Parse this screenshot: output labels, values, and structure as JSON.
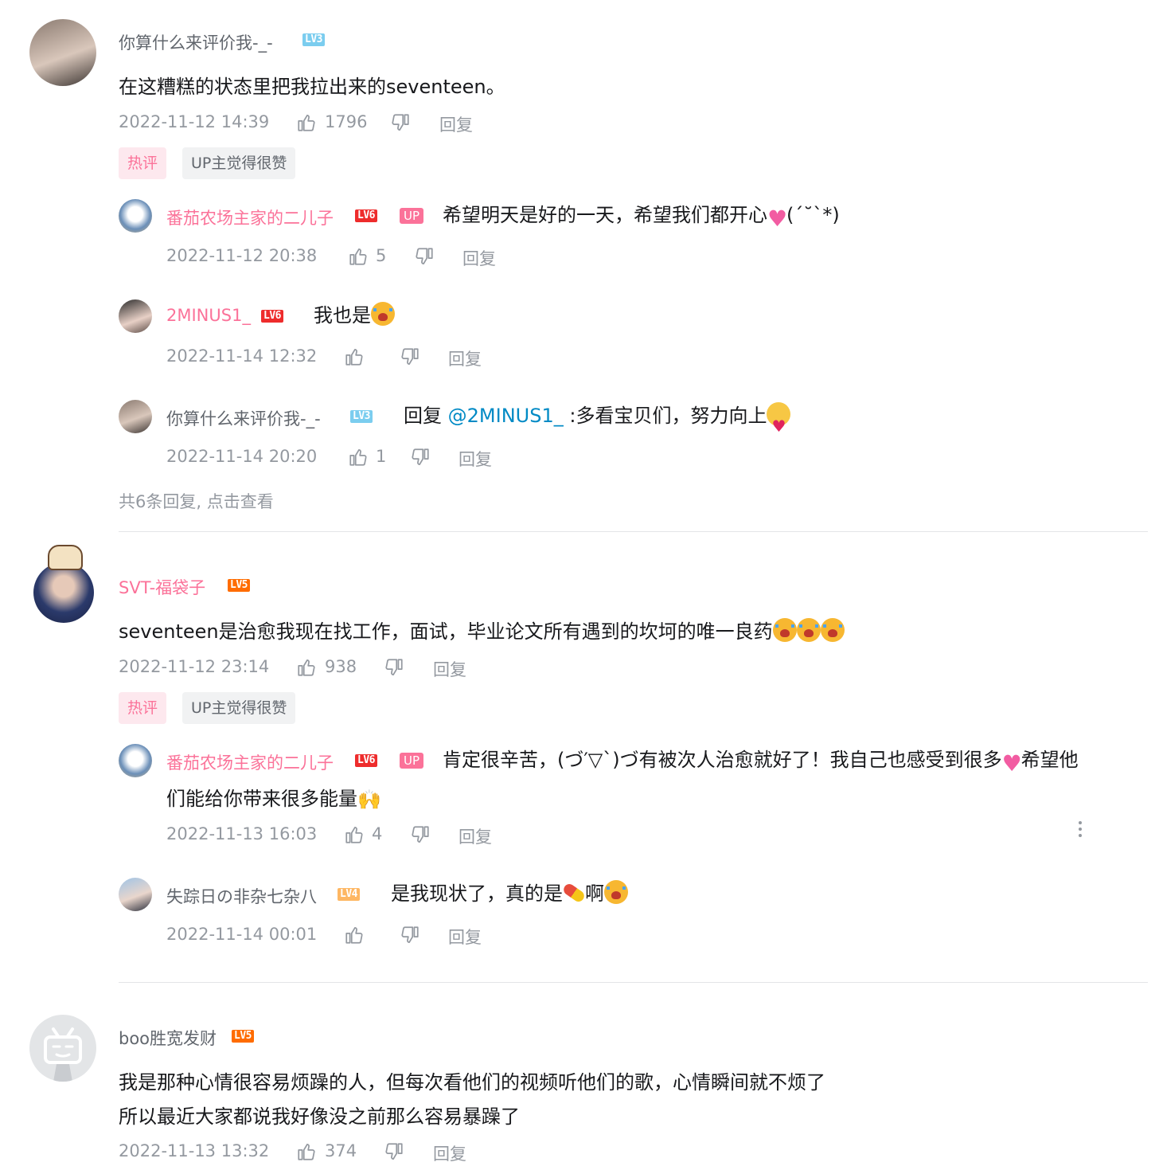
{
  "comments": [
    {
      "user": "你算什么来评价我-_-",
      "level": "LV3",
      "text": "在这糟糕的状态里把我拉出来的seventeen。",
      "time": "2022-11-12 14:39",
      "likes": "1796",
      "reply_label": "回复",
      "tag_hot": "热评",
      "tag_up": "UP主觉得很赞",
      "replies": [
        {
          "user": "番茄农场主家的二儿子",
          "level": "LV6",
          "up": "UP",
          "text": "希望明天是好的一天，希望我们都开心",
          "text_tail": "(´˘`*)",
          "time": "2022-11-12 20:38",
          "likes": "5",
          "reply_label": "回复"
        },
        {
          "user": "2MINUS1_",
          "level": "LV6",
          "text": "我也是",
          "time": "2022-11-14 12:32",
          "likes": "",
          "reply_label": "回复"
        },
        {
          "user": "你算什么来评价我-_-",
          "level": "LV3",
          "reply_word": "回复",
          "mention": "@2MINUS1_",
          "text": ":多看宝贝们，努力向上",
          "time": "2022-11-14 20:20",
          "likes": "1",
          "reply_label": "回复"
        }
      ],
      "more_replies": "共6条回复, 点击查看"
    },
    {
      "user": "SVT-福袋子",
      "level": "LV5",
      "text": "seventeen是治愈我现在找工作，面试，毕业论文所有遇到的坎坷的唯一良药",
      "time": "2022-11-12 23:14",
      "likes": "938",
      "reply_label": "回复",
      "tag_hot": "热评",
      "tag_up": "UP主觉得很赞",
      "replies": [
        {
          "user": "番茄农场主家的二儿子",
          "level": "LV6",
          "up": "UP",
          "text": "肯定很辛苦，(づ′▽`)づ有被次人治愈就好了！我自己也感受到很多",
          "text_tail": "希望他",
          "text_line2": "们能给你带来很多能量",
          "time": "2022-11-13 16:03",
          "likes": "4",
          "reply_label": "回复"
        },
        {
          "user": "失踪日の非杂七杂八",
          "level": "LV4",
          "text": "是我现状了，真的是",
          "text_mid": "啊",
          "time": "2022-11-14 00:01",
          "likes": "",
          "reply_label": "回复"
        }
      ]
    },
    {
      "user": "boo胜宽发财",
      "level": "LV5",
      "text": "我是那种心情很容易烦躁的人，但每次看他们的视频听他们的歌，心情瞬间就不烦了",
      "text_line2": "所以最近大家都说我好像没之前那么容易暴躁了",
      "time": "2022-11-13 13:32",
      "likes": "374",
      "reply_label": "回复"
    }
  ],
  "icons": {
    "like": "thumbs-up-icon",
    "dislike": "thumbs-down-icon",
    "more": "more-vertical-icon"
  },
  "colors": {
    "pink": "#fb7299",
    "grey": "#61666d",
    "meta": "#9499a0",
    "link": "#008ac5",
    "divider": "#e3e5e7"
  }
}
